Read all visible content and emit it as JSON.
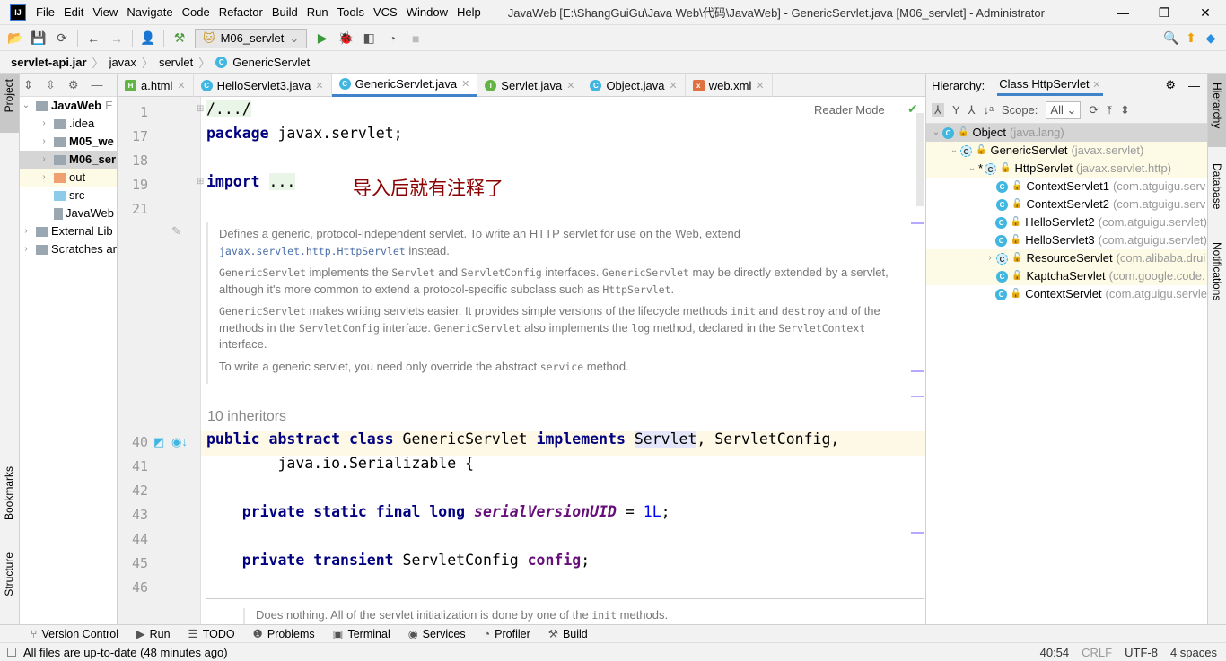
{
  "window": {
    "title": "JavaWeb [E:\\ShangGuiGu\\Java Web\\代码\\JavaWeb] - GenericServlet.java [M06_servlet] - Administrator",
    "logo": "IJ",
    "menu": [
      "File",
      "Edit",
      "View",
      "Navigate",
      "Code",
      "Refactor",
      "Build",
      "Run",
      "Tools",
      "VCS",
      "Window",
      "Help"
    ]
  },
  "toolbar": {
    "run_config": "M06_servlet"
  },
  "breadcrumb": [
    "servlet-api.jar",
    "javax",
    "servlet",
    "GenericServlet"
  ],
  "left_stripe": {
    "project": "Project",
    "bookmarks": "Bookmarks",
    "structure": "Structure"
  },
  "project": {
    "items": [
      {
        "label": "JavaWeb",
        "suffix": "E",
        "arrow": "expanded",
        "bold": true,
        "indent": 0
      },
      {
        "label": ".idea",
        "arrow": "collapsed",
        "indent": 1
      },
      {
        "label": "M05_we",
        "arrow": "collapsed",
        "bold": true,
        "indent": 1
      },
      {
        "label": "M06_ser",
        "arrow": "collapsed",
        "bold": true,
        "indent": 1,
        "selected": true
      },
      {
        "label": "out",
        "arrow": "collapsed",
        "indent": 1,
        "folder_color": "#f0a070",
        "highlight": true
      },
      {
        "label": "src",
        "arrow": "",
        "indent": 1,
        "folder_color": "#8ccce8"
      },
      {
        "label": "JavaWeb",
        "arrow": "",
        "indent": 1,
        "file": true
      },
      {
        "label": "External Lib",
        "arrow": "collapsed",
        "indent": 0
      },
      {
        "label": "Scratches ar",
        "arrow": "collapsed",
        "indent": 0
      }
    ]
  },
  "tabs": [
    {
      "label": "a.html",
      "icon": "html"
    },
    {
      "label": "HelloServlet3.java",
      "icon": "class"
    },
    {
      "label": "GenericServlet.java",
      "icon": "class",
      "active": true
    },
    {
      "label": "Servlet.java",
      "icon": "interface"
    },
    {
      "label": "Object.java",
      "icon": "class"
    },
    {
      "label": "web.xml",
      "icon": "xml"
    }
  ],
  "editor": {
    "reader_mode": "Reader Mode",
    "annotation": "导入后就有注释了",
    "inheritors": "10 inheritors",
    "lines": [
      {
        "n": "1",
        "tokens": [
          [
            "/.../",
            "fold2"
          ]
        ]
      },
      {
        "n": "17",
        "tokens": [
          [
            "package ",
            "kw"
          ],
          [
            "javax.servlet;",
            ""
          ]
        ]
      },
      {
        "n": "18",
        "tokens": []
      },
      {
        "n": "19",
        "tokens": [
          [
            "import ",
            "kw"
          ],
          [
            "...",
            "fold2"
          ]
        ]
      },
      {
        "n": "21",
        "tokens": []
      },
      {
        "n": "40",
        "tokens": [
          [
            "public abstract class ",
            "kw"
          ],
          [
            "GenericServlet ",
            ""
          ],
          [
            "implements ",
            "kw"
          ],
          [
            "Servlet",
            "hl"
          ],
          [
            ", ServletConfig,",
            ""
          ]
        ]
      },
      {
        "n": "41",
        "tokens": [
          [
            "        java.io.Serializable {",
            ""
          ]
        ]
      },
      {
        "n": "42",
        "tokens": []
      },
      {
        "n": "43",
        "tokens": [
          [
            "    private static final long ",
            "kw"
          ],
          [
            "serialVersionUID",
            "sfld"
          ],
          [
            " = ",
            ""
          ],
          [
            "1L",
            "num"
          ],
          [
            ";",
            ""
          ]
        ]
      },
      {
        "n": "44",
        "tokens": []
      },
      {
        "n": "45",
        "tokens": [
          [
            "    private transient ",
            "kw"
          ],
          [
            "ServletConfig ",
            ""
          ],
          [
            "config",
            "fld"
          ],
          [
            ";",
            ""
          ]
        ]
      },
      {
        "n": "46",
        "tokens": []
      }
    ],
    "doc": [
      [
        [
          "Defines a generic, protocol-independent servlet. To write an HTTP servlet for use on the Web, extend ",
          ""
        ],
        [
          "javax.servlet.http.HttpServlet",
          "mono link"
        ],
        [
          " instead.",
          ""
        ]
      ],
      [
        [
          "GenericServlet",
          "mono"
        ],
        [
          " implements the ",
          ""
        ],
        [
          "Servlet",
          "mono"
        ],
        [
          " and ",
          ""
        ],
        [
          "ServletConfig",
          "mono"
        ],
        [
          " interfaces. ",
          ""
        ],
        [
          "GenericServlet",
          "mono"
        ],
        [
          " may be directly extended by a servlet, although it's more common to extend a protocol-specific subclass such as ",
          ""
        ],
        [
          "HttpServlet",
          "mono"
        ],
        [
          ".",
          ""
        ]
      ],
      [
        [
          "GenericServlet",
          "mono"
        ],
        [
          " makes writing servlets easier. It provides simple versions of the lifecycle methods ",
          ""
        ],
        [
          "init",
          "mono"
        ],
        [
          " and ",
          ""
        ],
        [
          "destroy",
          "mono"
        ],
        [
          " and of the methods in the ",
          ""
        ],
        [
          "ServletConfig",
          "mono"
        ],
        [
          " interface. ",
          ""
        ],
        [
          "GenericServlet",
          "mono"
        ],
        [
          " also implements the ",
          ""
        ],
        [
          "log",
          "mono"
        ],
        [
          " method, declared in the ",
          ""
        ],
        [
          "ServletContext",
          "mono"
        ],
        [
          " interface.",
          ""
        ]
      ],
      [
        [
          "To write a generic servlet, you need only override the abstract ",
          ""
        ],
        [
          "service",
          "mono"
        ],
        [
          " method.",
          ""
        ]
      ]
    ],
    "doc_bottom": [
      [
        "Does nothing. All of the servlet initialization is done by one of the ",
        ""
      ],
      [
        "init",
        "mono"
      ],
      [
        " methods.",
        ""
      ]
    ]
  },
  "hierarchy": {
    "label": "Hierarchy:",
    "tab": "Class HttpServlet",
    "scope_label": "Scope:",
    "scope_value": "All",
    "items": [
      {
        "name": "Object",
        "pkg": "(java.lang)",
        "indent": 0,
        "arrow": "expanded",
        "selected": true
      },
      {
        "name": "GenericServlet",
        "pkg": "(javax.servlet)",
        "indent": 1,
        "arrow": "expanded",
        "abstract": true,
        "highlight": true
      },
      {
        "name": "HttpServlet",
        "pkg": "(javax.servlet.http)",
        "indent": 2,
        "arrow": "expanded",
        "abstract": true,
        "star": "*",
        "highlight": true
      },
      {
        "name": "ContextServlet1",
        "pkg": "(com.atguigu.serv",
        "indent": 3
      },
      {
        "name": "ContextServlet2",
        "pkg": "(com.atguigu.serv",
        "indent": 3
      },
      {
        "name": "HelloServlet2",
        "pkg": "(com.atguigu.servlet)",
        "indent": 3
      },
      {
        "name": "HelloServlet3",
        "pkg": "(com.atguigu.servlet)",
        "indent": 3
      },
      {
        "name": "ResourceServlet",
        "pkg": "(com.alibaba.drui",
        "indent": 3,
        "arrow": "collapsed",
        "abstract": true,
        "highlight": true
      },
      {
        "name": "KaptchaServlet",
        "pkg": "(com.google.code.",
        "indent": 3,
        "highlight": true
      },
      {
        "name": "ContextServlet",
        "pkg": "(com.atguigu.servle",
        "indent": 3
      }
    ]
  },
  "right_stripe": {
    "hierarchy": "Hierarchy",
    "database": "Database",
    "notifications": "Notifications"
  },
  "tool_windows": [
    "Version Control",
    "Run",
    "TODO",
    "Problems",
    "Terminal",
    "Services",
    "Profiler",
    "Build"
  ],
  "tool_window_icons": [
    "⑂",
    "▶",
    "☰",
    "❶",
    "▣",
    "◉",
    "◔",
    "⚒"
  ],
  "status": {
    "message": "All files are up-to-date (48 minutes ago)",
    "position": "40:54",
    "line_sep": "CRLF",
    "encoding": "UTF-8",
    "indent": "4 spaces"
  }
}
